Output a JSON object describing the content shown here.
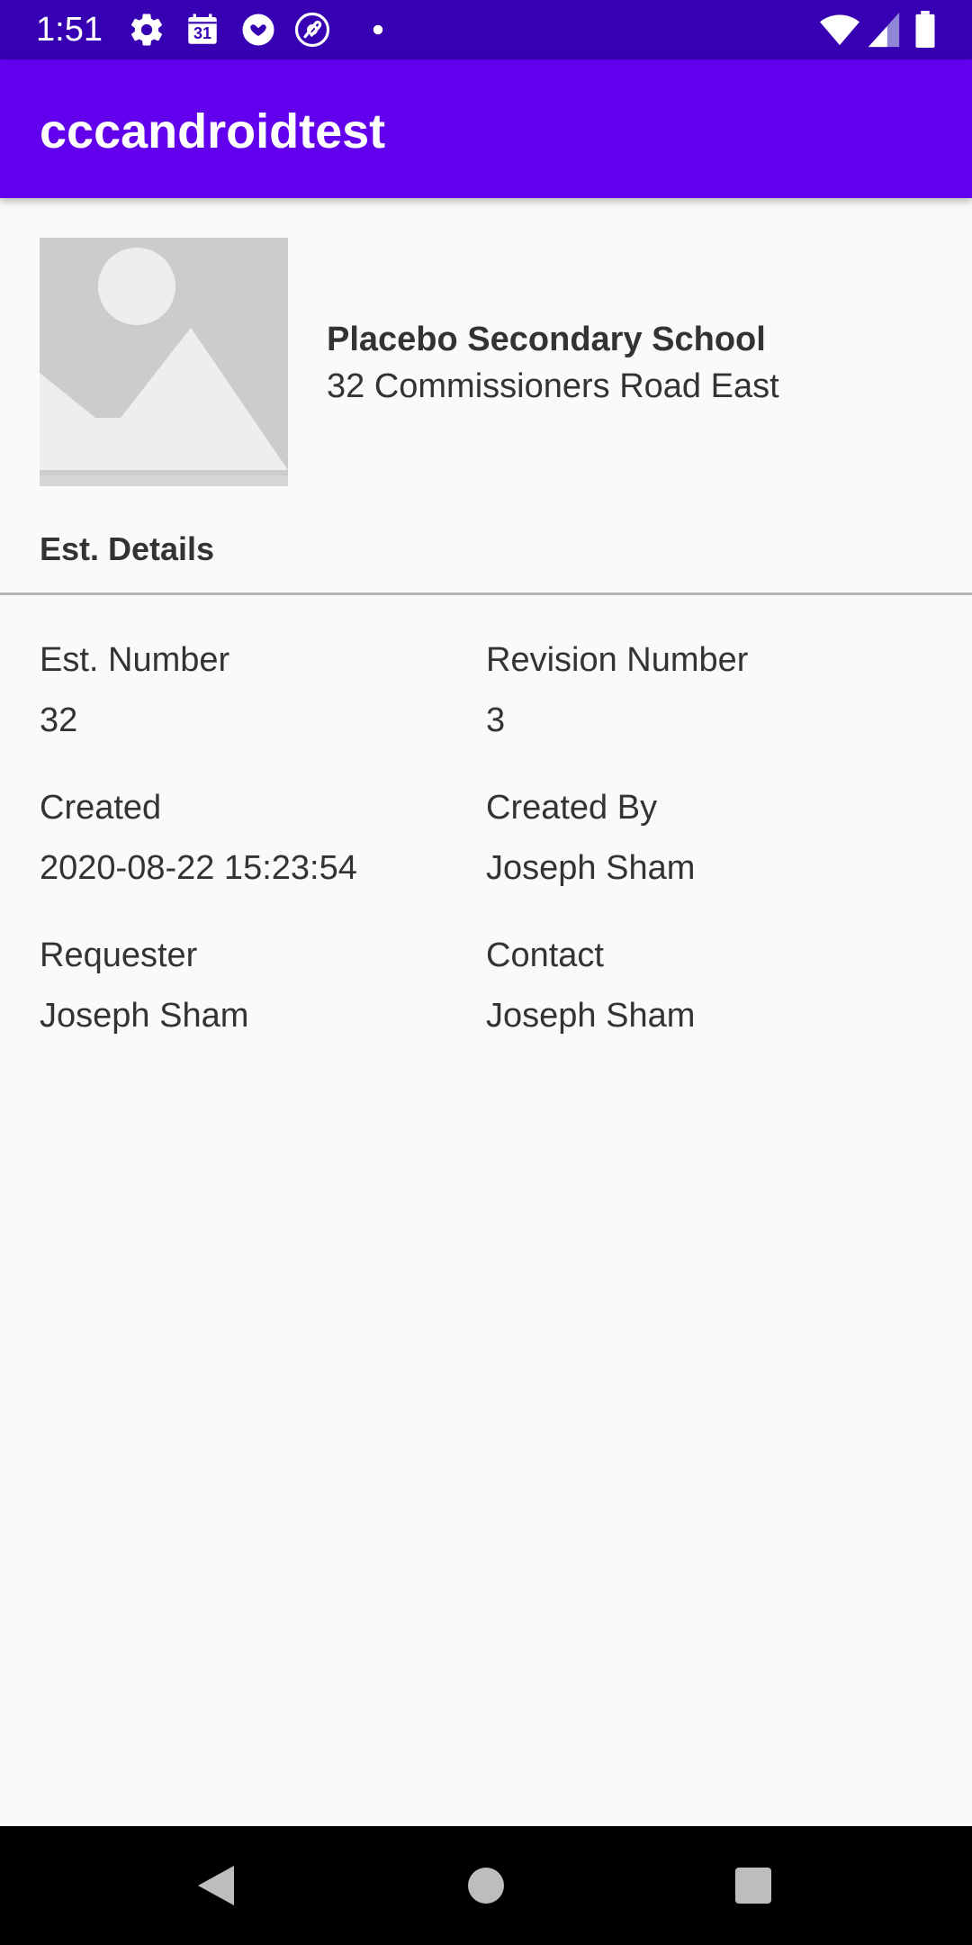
{
  "status_bar": {
    "time": "1:51",
    "calendar_day": "31",
    "icons": [
      "gear-icon",
      "calendar-icon",
      "heart-badge-icon",
      "loop-icon",
      "dot-icon",
      "wifi-icon",
      "signal-icon",
      "battery-icon"
    ]
  },
  "app_bar": {
    "title": "cccandroidtest"
  },
  "header": {
    "school_name": "Placebo Secondary School",
    "address": "32 Commissioners Road East"
  },
  "section": {
    "title": "Est. Details"
  },
  "details": {
    "est_number_label": "Est. Number",
    "est_number_value": "32",
    "revision_number_label": "Revision Number",
    "revision_number_value": "3",
    "created_label": "Created",
    "created_value": "2020-08-22 15:23:54",
    "created_by_label": "Created By",
    "created_by_value": "Joseph Sham",
    "requester_label": "Requester",
    "requester_value": "Joseph Sham",
    "contact_label": "Contact",
    "contact_value": "Joseph Sham"
  },
  "colors": {
    "status_bar": "#3700b3",
    "app_bar": "#6200ee",
    "background": "#fafafa",
    "text": "#333333"
  }
}
